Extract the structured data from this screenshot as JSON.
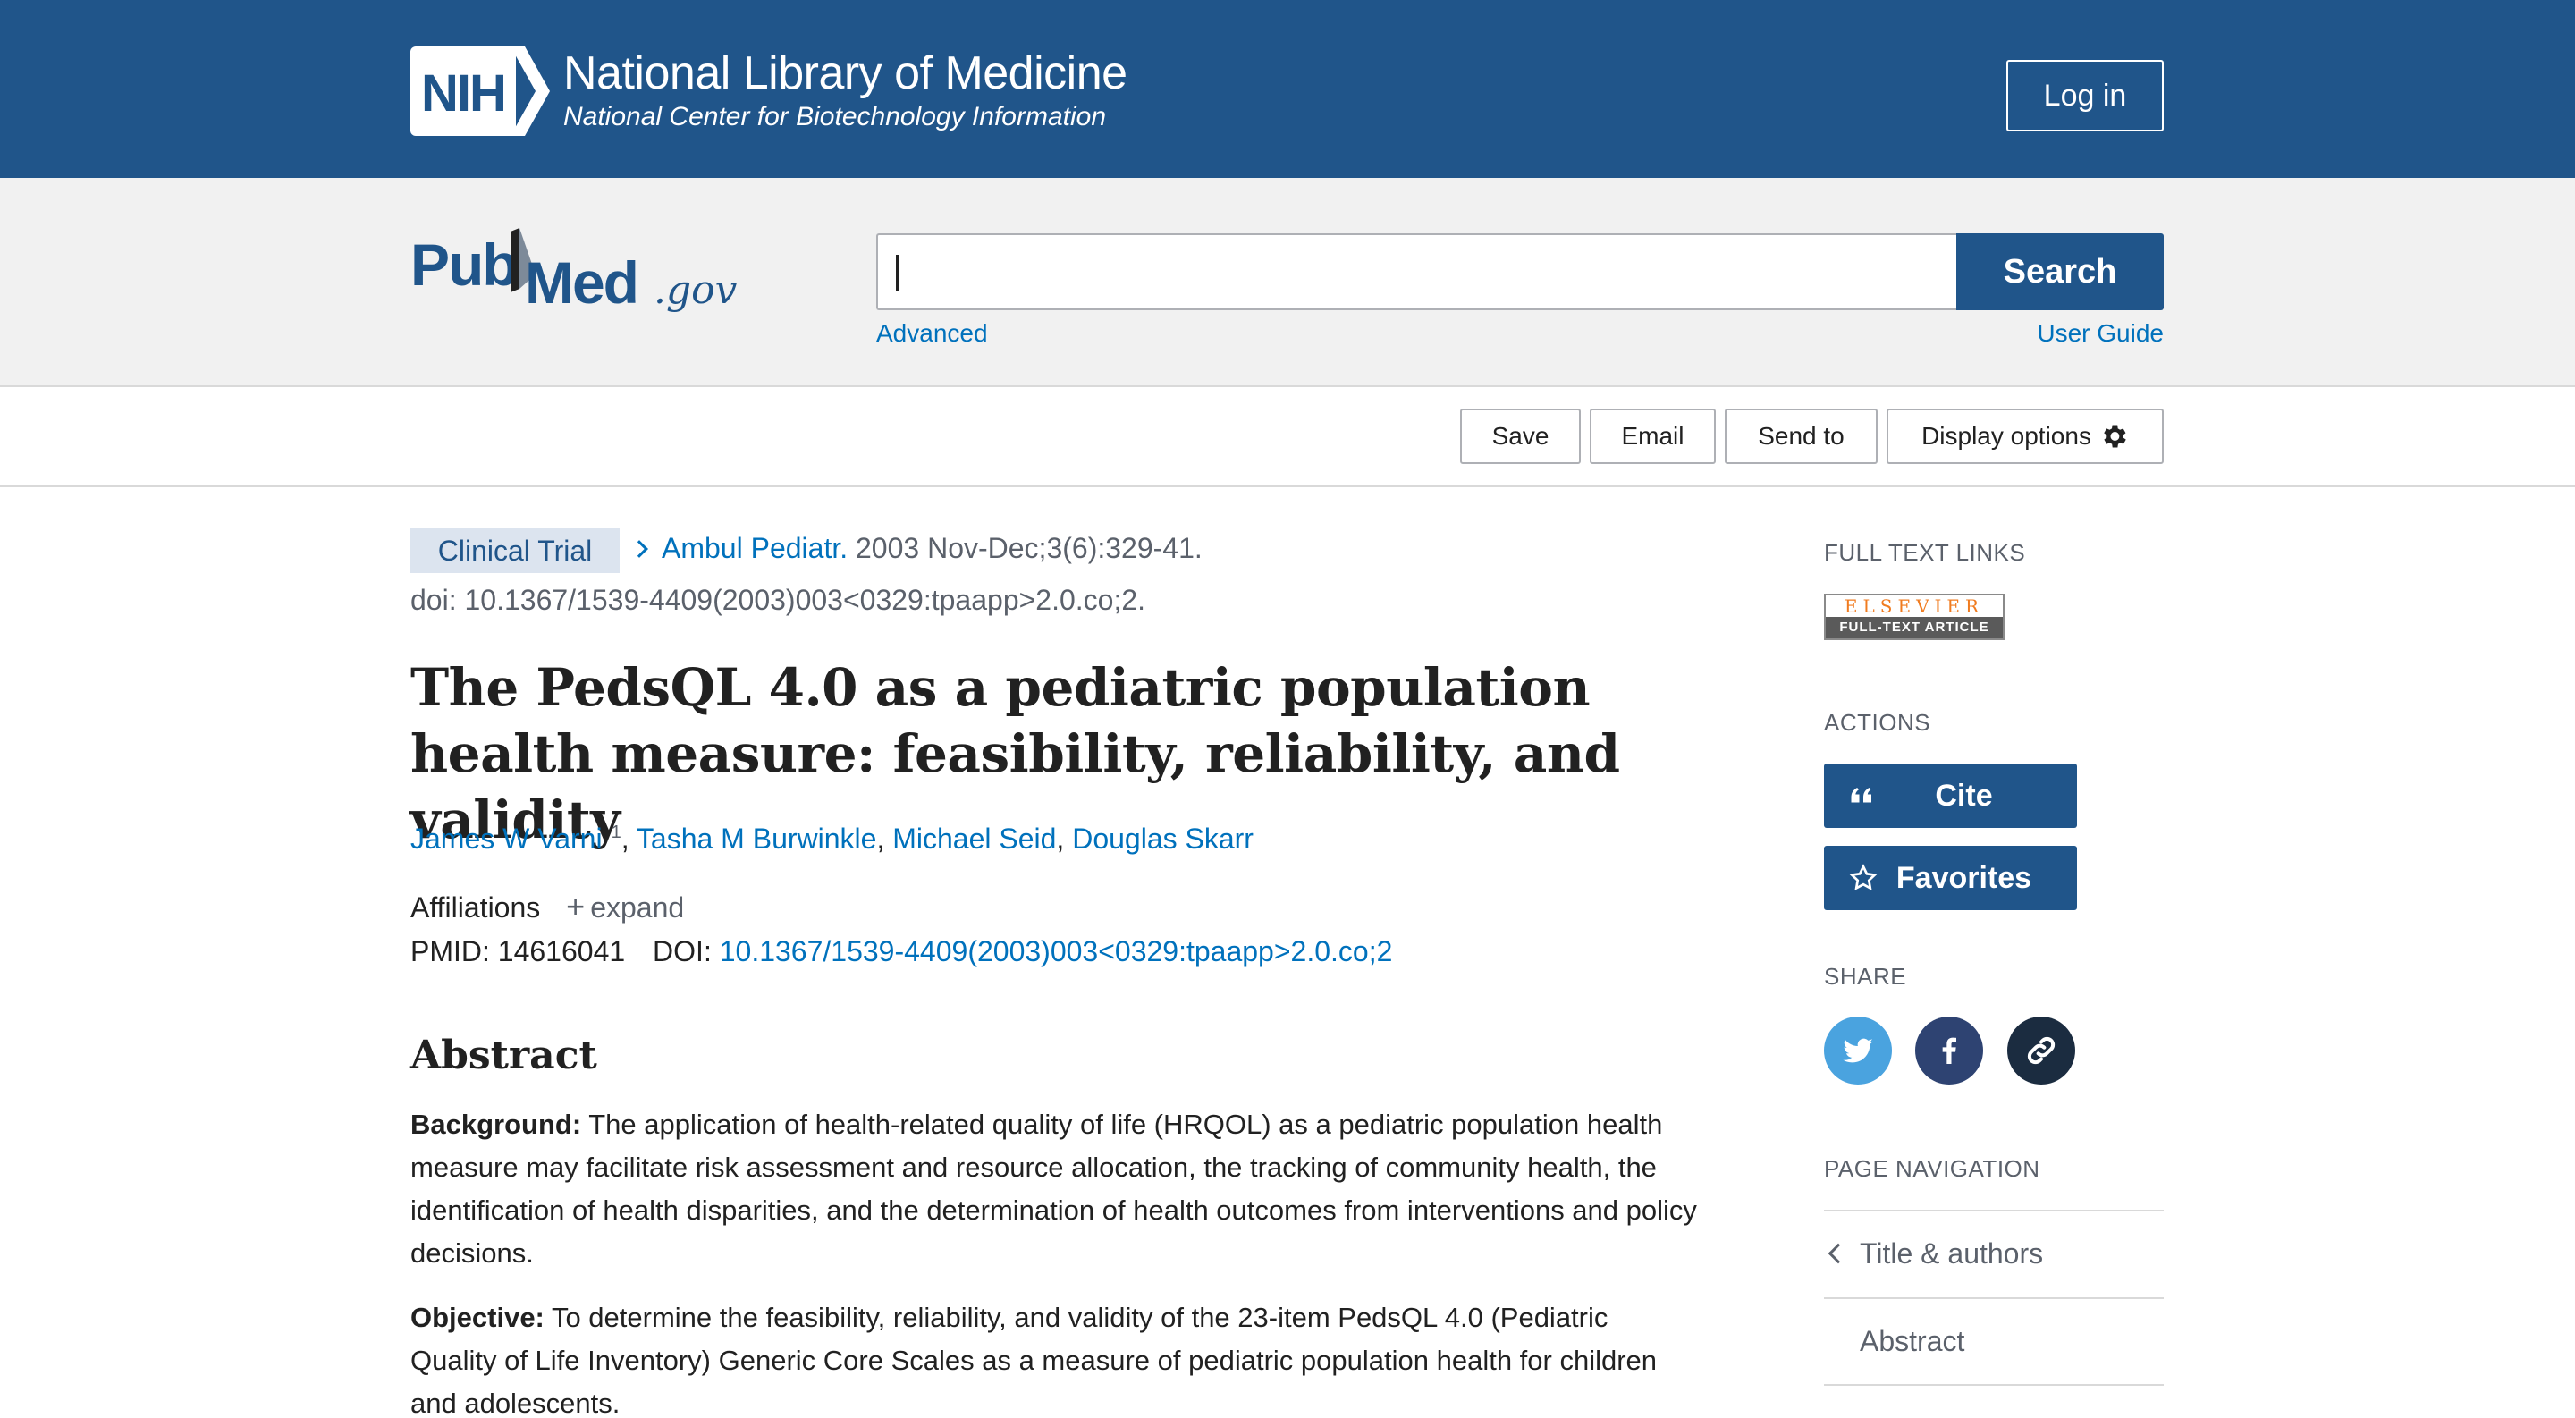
{
  "header": {
    "logo_text": "NIH",
    "title": "National Library of Medicine",
    "subtitle": "National Center for Biotechnology Information",
    "login_label": "Log in"
  },
  "search": {
    "logo_text": "PubMed.gov",
    "input_value": "",
    "button_label": "Search",
    "advanced_label": "Advanced",
    "user_guide_label": "User Guide"
  },
  "toolbar": {
    "save_label": "Save",
    "email_label": "Email",
    "send_to_label": "Send to",
    "display_options_label": "Display options"
  },
  "article": {
    "publication_type": "Clinical Trial",
    "journal": "Ambul Pediatr.",
    "citation": "2003 Nov-Dec;3(6):329-41.",
    "doi_line": "doi: 10.1367/1539-4409(2003)003<0329:tpaapp>2.0.co;2.",
    "title": "The PedsQL 4.0 as a pediatric population health measure: feasibility, reliability, and validity",
    "authors": [
      {
        "name": "James W Varni",
        "sup": "1"
      },
      {
        "name": "Tasha M Burwinkle"
      },
      {
        "name": "Michael Seid"
      },
      {
        "name": "Douglas Skarr"
      }
    ],
    "affiliations_label": "Affiliations",
    "expand_label": "expand",
    "pmid_label": "PMID:",
    "pmid": "14616041",
    "doi_label": "DOI:",
    "doi": "10.1367/1539-4409(2003)003<0329:tpaapp>2.0.co;2"
  },
  "abstract": {
    "heading": "Abstract",
    "background_label": "Background:",
    "background_text": " The application of health-related quality of life (HRQOL) as a pediatric population health measure may facilitate risk assessment and resource allocation, the tracking of community health, the identification of health disparities, and the determination of health outcomes from interventions and policy decisions.",
    "objective_label": "Objective:",
    "objective_text": " To determine the feasibility, reliability, and validity of the 23-item PedsQL 4.0 (Pediatric Quality of Life Inventory) Generic Core Scales as a measure of pediatric population health for children and adolescents."
  },
  "sidebar": {
    "full_text_heading": "FULL TEXT LINKS",
    "elsevier_top": "ELSEVIER",
    "elsevier_bottom": "FULL-TEXT ARTICLE",
    "actions_heading": "ACTIONS",
    "cite_label": "Cite",
    "favorites_label": "Favorites",
    "share_heading": "SHARE",
    "page_nav_heading": "PAGE NAVIGATION",
    "nav_items": [
      "Title & authors",
      "Abstract"
    ]
  },
  "colors": {
    "brand_blue": "#20558a",
    "link_blue": "#0071bc",
    "twitter": "#4aa3df",
    "facebook": "#2e4372",
    "link_share": "#1b2c40"
  }
}
